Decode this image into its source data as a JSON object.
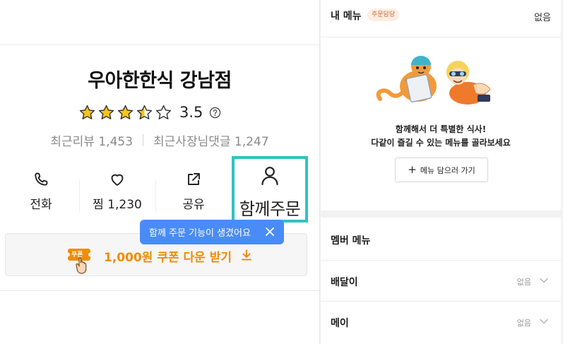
{
  "store": {
    "name": "우아한한식 강남점",
    "rating": "3.5",
    "rating_stars": 3.5,
    "recent_reviews": "최근리뷰 1,453",
    "recent_owner_replies": "최근사장님댓글 1,247"
  },
  "actions": {
    "call": {
      "label": "전화",
      "icon": "phone-icon"
    },
    "jjim": {
      "label": "찜 1,230",
      "icon": "heart-icon"
    },
    "share": {
      "label": "공유",
      "icon": "share-icon"
    },
    "together": {
      "label": "함께주문",
      "icon": "person-icon"
    }
  },
  "tooltip": {
    "text": "함께 주문 기능이 생겼어요"
  },
  "coupon": {
    "badge": "쿠폰",
    "text": "1,000원 쿠폰 다운 받기"
  },
  "my_menu": {
    "title": "내 메뉴",
    "badge": "주문담당",
    "status": "없음",
    "promo_line1": "함께해서 더 특별한 식사!",
    "promo_line2": "다같이 즐길 수 있는 메뉴를 골라보세요",
    "add_button": "메뉴 담으러 가기"
  },
  "member_menu": {
    "title": "멤버 메뉴",
    "members": [
      {
        "name": "배달이",
        "status": "없음"
      },
      {
        "name": "메이",
        "status": "없음"
      }
    ]
  },
  "colors": {
    "accent_teal": "#2ec4c0",
    "tooltip_blue": "#4a8cf7",
    "coupon_orange": "#f28c00",
    "star": "#f5c518"
  }
}
